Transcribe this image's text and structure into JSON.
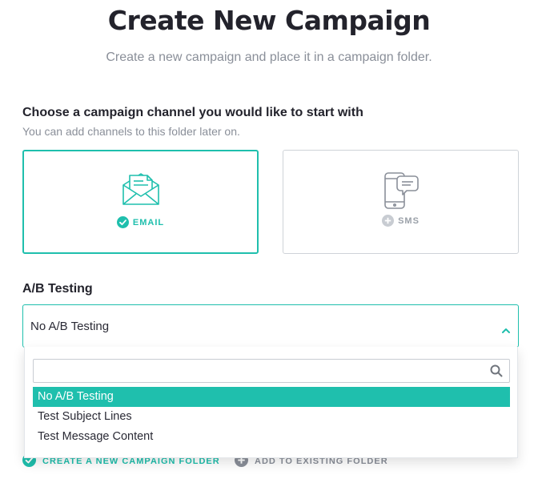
{
  "header": {
    "title": "Create New Campaign",
    "subtitle": "Create a new campaign and place it in a campaign folder."
  },
  "channel_section": {
    "heading": "Choose a campaign channel you would like to start with",
    "help": "You can add channels to this folder later on.",
    "channels": [
      {
        "label": "EMAIL",
        "selected": true,
        "icon": "envelope-icon"
      },
      {
        "label": "SMS",
        "selected": false,
        "icon": "phone-chat-icon"
      }
    ]
  },
  "ab_testing": {
    "label": "A/B Testing",
    "value": "No A/B Testing",
    "search_placeholder": "",
    "options": [
      "No A/B Testing",
      "Test Subject Lines",
      "Test Message Content"
    ],
    "selected_index": 0
  },
  "footer": {
    "create_label": "CREATE A NEW CAMPAIGN FOLDER",
    "existing_label": "ADD TO EXISTING FOLDER"
  },
  "colors": {
    "accent": "#1fbfad",
    "muted": "#8a8f99",
    "text": "#23232c"
  }
}
